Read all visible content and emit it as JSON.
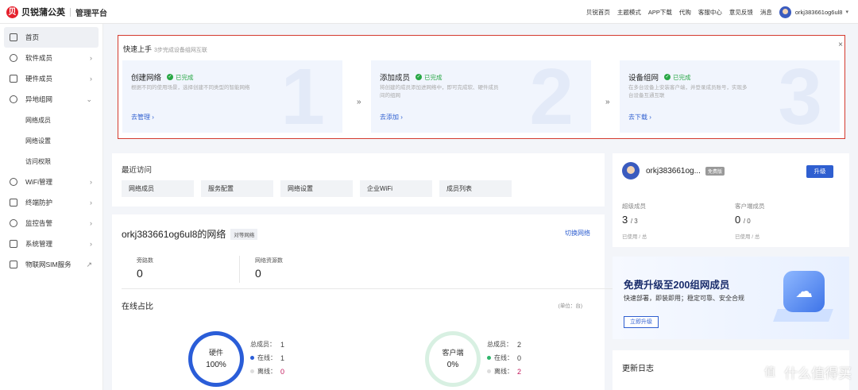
{
  "header": {
    "logo_mark": "贝",
    "logo_text": "贝锐蒲公英",
    "logo_sub": "管理平台",
    "nav": [
      "贝锐首页",
      "主题模式",
      "APP下载",
      "代购",
      "客服中心",
      "意见反馈",
      "消息"
    ],
    "user": "orkj383661og6ul8"
  },
  "sidebar": {
    "items": [
      {
        "label": "首页"
      },
      {
        "label": "软件成员"
      },
      {
        "label": "硬件成员"
      },
      {
        "label": "异地组网"
      },
      {
        "label": "网络成员"
      },
      {
        "label": "网络设置"
      },
      {
        "label": "访问权限"
      },
      {
        "label": "WiFi管理"
      },
      {
        "label": "终端防护"
      },
      {
        "label": "监控告警"
      },
      {
        "label": "系统管理"
      },
      {
        "label": "物联网SIM服务"
      }
    ]
  },
  "quick": {
    "title": "快速上手",
    "subtitle": "3步完成设备组网互联",
    "done_label": "已完成",
    "steps": [
      {
        "title": "创建网络",
        "desc": "根据不同的使用场景，选择创建不同类型的智能网络",
        "link": "去管理",
        "num": "1"
      },
      {
        "title": "添加成员",
        "desc": "将创建的成员添加进网络中，即可完成软、硬件成员间的组网",
        "link": "去添加",
        "num": "2"
      },
      {
        "title": "设备组网",
        "desc": "在多台设备上安装客户端，并登录成员账号，实现多台设备互通互联",
        "link": "去下载",
        "num": "3"
      }
    ]
  },
  "recent": {
    "title": "最近访问",
    "items": [
      "网络成员",
      "服务配置",
      "网络设置",
      "企业WiFi",
      "成员列表"
    ]
  },
  "network": {
    "name": "orkj383661og6ul8的网络",
    "tag": "对等网络",
    "switch_label": "切换网络",
    "stats": [
      {
        "label": "旁路数",
        "value": "0"
      },
      {
        "label": "网络资源数",
        "value": "0"
      }
    ],
    "online_title": "在线占比",
    "unit": "(单位：台)",
    "rings": [
      {
        "name": "硬件",
        "pct": "100%",
        "pct_value": 1.0,
        "total_label": "总成员：",
        "total": "1",
        "online_label": "在线：",
        "online": "1",
        "offline_label": "离线：",
        "offline": "0",
        "color": "#2a5dd8"
      },
      {
        "name": "客户端",
        "pct": "0%",
        "pct_value": 0.0,
        "total_label": "总成员：",
        "total": "2",
        "online_label": "在线：",
        "online": "0",
        "offline_label": "离线：",
        "offline": "2",
        "color": "#2fb56b"
      }
    ]
  },
  "user_card": {
    "name": "orkj383661og...",
    "tag": "免费版",
    "upgrade": "升级",
    "stats": [
      {
        "label": "超级成员",
        "value": "3",
        "total": "/ 3",
        "sub": "已使用 / 总"
      },
      {
        "label": "客户端成员",
        "value": "0",
        "total": "/ 0",
        "sub": "已使用 / 总"
      }
    ]
  },
  "promo": {
    "title": "免费升级至200组网成员",
    "subtitle": "快速部署，即装即用；稳定可靠、安全合规",
    "button": "立即升级"
  },
  "changelog": {
    "title": "更新日志"
  },
  "watermark": {
    "text": "什么值得买",
    "icon": "值"
  },
  "colors": {
    "accent": "#2f5fd0",
    "highlight_border": "#d43a2e",
    "done": "#28a745"
  }
}
